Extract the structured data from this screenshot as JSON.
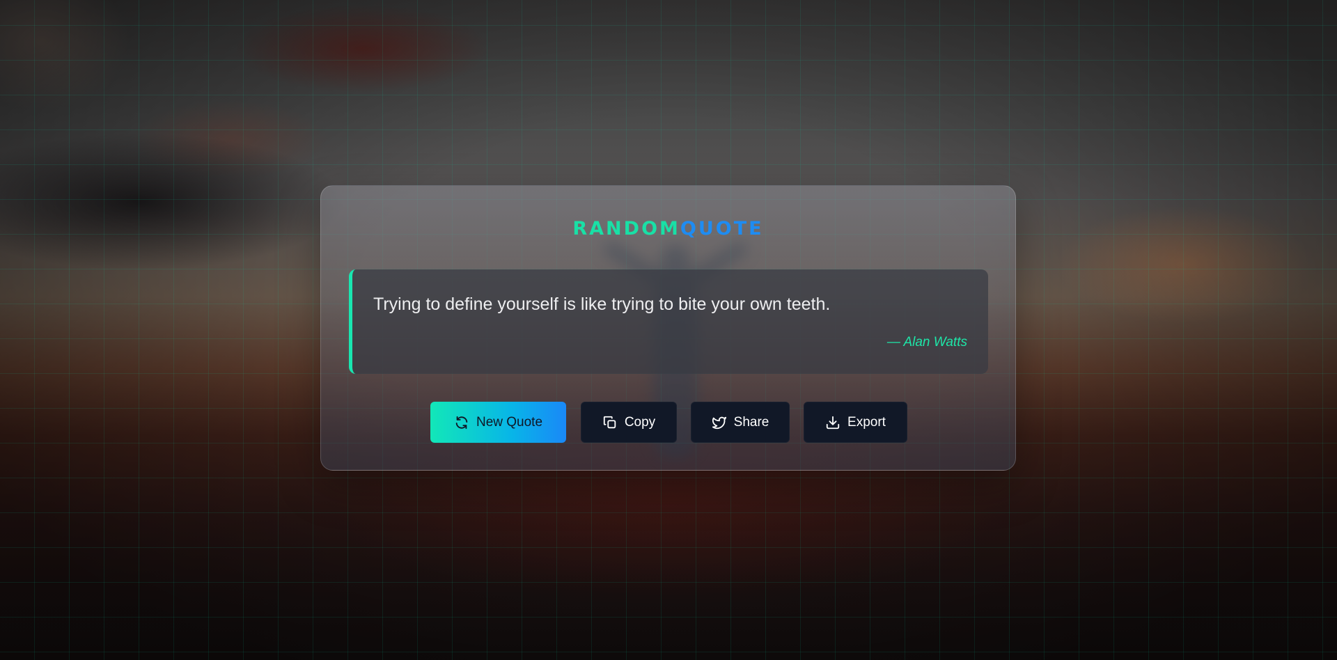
{
  "app": {
    "logo_part1": "RANDOM",
    "logo_part2": "QUOTE"
  },
  "quote": {
    "text": "Trying to define yourself is like trying to bite your own teeth.",
    "author": "— Alan Watts"
  },
  "actions": {
    "new_quote_label": "New Quote",
    "copy_label": "Copy",
    "share_label": "Share",
    "export_label": "Export"
  },
  "icons": {
    "new_quote": "refresh-icon",
    "copy": "copy-icon",
    "share": "twitter-icon",
    "export": "download-icon"
  },
  "colors": {
    "accent_green": "#19e0a6",
    "accent_blue": "#1e8cf2",
    "button_dark": "#111827"
  }
}
